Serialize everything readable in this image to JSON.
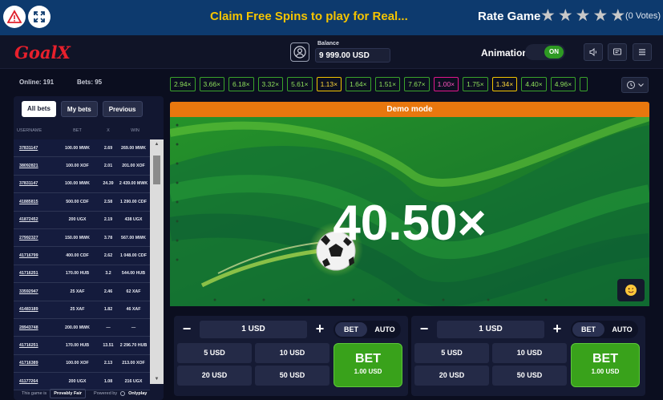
{
  "topbar": {
    "promo": "Claim Free Spins to play for Real...",
    "rate_label": "Rate Game",
    "votes": "(0 Votes)",
    "stars": 0
  },
  "header": {
    "logo": "GoalX",
    "balance_label": "Balance",
    "balance_value": "9 999.00 USD",
    "animation_label": "Animation",
    "animation_state": "ON"
  },
  "stats": {
    "online": "Online: 191",
    "bets": "Bets: 95"
  },
  "left_tabs": [
    "All bets",
    "My bets",
    "Previous"
  ],
  "bets_columns": [
    "USERNAME",
    "BET",
    "X",
    "WIN"
  ],
  "bets_rows": [
    [
      "37831147",
      "100.00 MWK",
      "2.69",
      "269.00 MWK"
    ],
    [
      "38092821",
      "100.00 XOF",
      "2.01",
      "201.00 XOF"
    ],
    [
      "37831147",
      "100.00 MWK",
      "24.39",
      "2 439.00 MWK"
    ],
    [
      "41885815",
      "500.00 CDF",
      "2.58",
      "1 290.00 CDF"
    ],
    [
      "41872452",
      "200 UGX",
      "2.19",
      "438 UGX"
    ],
    [
      "27992327",
      "150.00 MWK",
      "3.78",
      "567.00 MWK"
    ],
    [
      "41716799",
      "400.00 CDF",
      "2.62",
      "1 048.00 CDF"
    ],
    [
      "41716251",
      "170.00 HUB",
      "3.2",
      "544.00 HUB"
    ],
    [
      "33592947",
      "25 XAF",
      "2.46",
      "62 XAF"
    ],
    [
      "41483189",
      "25 XAF",
      "1.82",
      "46 XAF"
    ],
    [
      "28943748",
      "200.00 MWK",
      "—",
      "—"
    ],
    [
      "41716251",
      "170.00 HUB",
      "13.51",
      "2 296.70 HUB"
    ],
    [
      "41716389",
      "100.00 XOF",
      "2.13",
      "213.00 XOF"
    ],
    [
      "41177264",
      "200 UGX",
      "1.08",
      "216 UGX"
    ]
  ],
  "footer": {
    "text": "This game is",
    "provably_fair": "Provably Fair",
    "powered": "Powered by",
    "brand": "Onlyplay"
  },
  "multipliers": [
    {
      "v": "2.94×",
      "c": "g"
    },
    {
      "v": "3.66×",
      "c": "g"
    },
    {
      "v": "6.18×",
      "c": "g"
    },
    {
      "v": "3.32×",
      "c": "g"
    },
    {
      "v": "5.61×",
      "c": "g"
    },
    {
      "v": "1.13×",
      "c": "y"
    },
    {
      "v": "1.64×",
      "c": "g"
    },
    {
      "v": "1.51×",
      "c": "g"
    },
    {
      "v": "7.67×",
      "c": "g"
    },
    {
      "v": "1.00×",
      "c": "p"
    },
    {
      "v": "1.75×",
      "c": "g"
    },
    {
      "v": "1.34×",
      "c": "y"
    },
    {
      "v": "4.40×",
      "c": "g"
    },
    {
      "v": "4.96×",
      "c": "g"
    },
    {
      "v": "",
      "c": "g"
    }
  ],
  "game": {
    "demo_label": "Demo mode",
    "multiplier": "40.50×"
  },
  "bet_panels": [
    {
      "amount": "1 USD",
      "mode_bet": "BET",
      "mode_auto": "AUTO",
      "quick": [
        "5 USD",
        "10 USD",
        "20 USD",
        "50 USD"
      ],
      "bet_label": "BET",
      "bet_amount": "1.00 USD"
    },
    {
      "amount": "1 USD",
      "mode_bet": "BET",
      "mode_auto": "AUTO",
      "quick": [
        "5 USD",
        "10 USD",
        "20 USD",
        "50 USD"
      ],
      "bet_label": "BET",
      "bet_amount": "1.00 USD"
    }
  ],
  "colors": {
    "accent_green": "#39a21b",
    "demo_orange": "#e8770e",
    "promo_yellow": "#f5c400",
    "header_blue": "#0d3a6e"
  }
}
